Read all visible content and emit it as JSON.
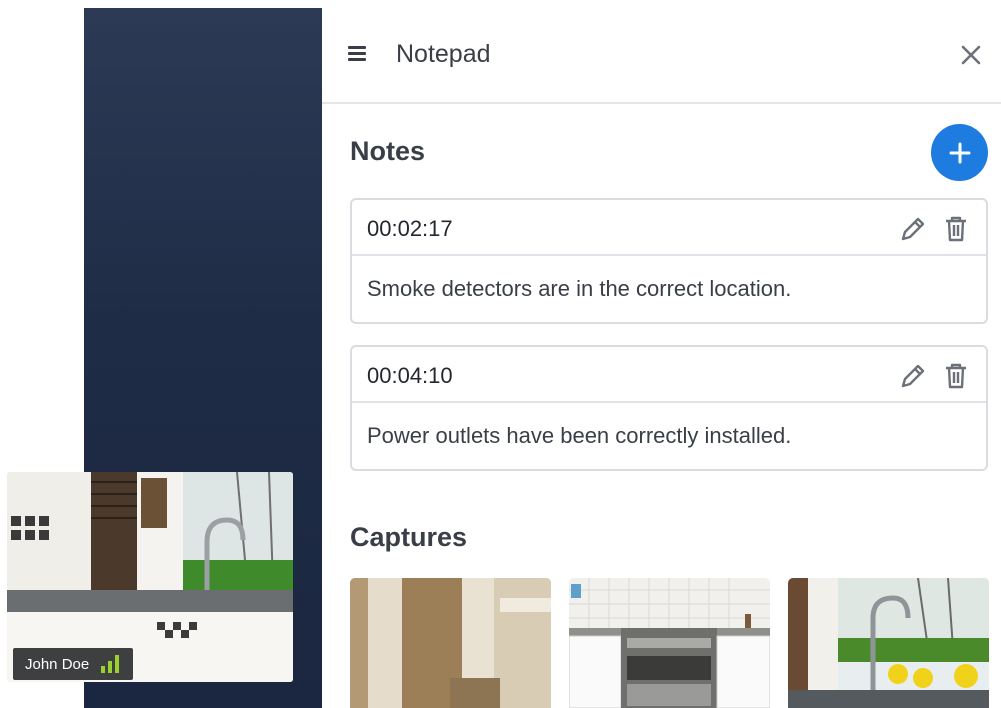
{
  "notepad": {
    "title": "Notepad",
    "notes_heading": "Notes",
    "captures_heading": "Captures",
    "notes": [
      {
        "timestamp": "00:02:17",
        "text": "Smoke detectors are in the correct location."
      },
      {
        "timestamp": "00:04:10",
        "text": "Power outlets have been correctly installed."
      }
    ]
  },
  "self_view": {
    "participant_name": "John Doe",
    "signal_bars": 3
  },
  "colors": {
    "accent": "#1e7be0",
    "video_background": "#1f2c46",
    "signal_green": "#9bd12f",
    "text_dark": "#3a3f47",
    "border": "#d9dce0"
  },
  "icons": [
    "menu-icon",
    "close-icon",
    "plus-icon",
    "pencil-icon",
    "trash-icon",
    "signal-bars-icon"
  ]
}
